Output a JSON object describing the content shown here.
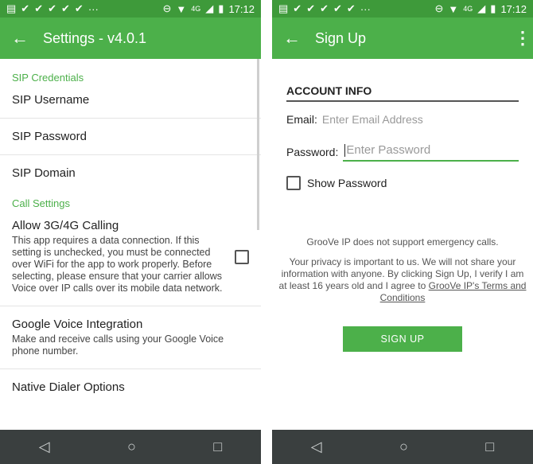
{
  "status_bar": {
    "time": "17:12",
    "network": "4G",
    "left_icons": [
      "notification-icon",
      "check-icon",
      "check-icon",
      "check-icon",
      "check-icon",
      "check-icon",
      "more-icon"
    ]
  },
  "settings": {
    "title": "Settings - v4.0.1",
    "sections": [
      {
        "heading": "SIP Credentials"
      },
      {
        "heading": "Call Settings"
      }
    ],
    "items": {
      "sip_username": "SIP Username",
      "sip_password": "SIP Password",
      "sip_domain": "SIP Domain",
      "allow_calling": "Allow 3G/4G Calling",
      "allow_calling_desc": "This app requires a data connection.  If this setting is unchecked, you must be connected over WiFi for the app to work properly. Before selecting, please ensure that your carrier allows Voice over IP calls over its mobile data network.",
      "google_voice": "Google Voice Integration",
      "google_voice_desc": "Make and receive calls using your Google Voice phone number.",
      "native_dialer": "Native Dialer Options"
    }
  },
  "signup": {
    "title": "Sign Up",
    "account_info": "ACCOUNT INFO",
    "email_label": "Email:",
    "email_placeholder": "Enter Email Address",
    "password_label": "Password:",
    "password_placeholder": "Enter Password",
    "show_password": "Show Password",
    "emergency_notice": "GrooVe IP does not support emergency calls.",
    "privacy_text": "Your privacy is important to us. We will not share your information with anyone. By clicking Sign Up, I verify I am at least 16 years old and I agree to",
    "terms_link": "GrooVe IP's Terms and Conditions",
    "button": "SIGN UP"
  },
  "colors": {
    "accent": "#4cb04a",
    "status": "#3e9a3a",
    "navbar": "#3a3f3f"
  }
}
